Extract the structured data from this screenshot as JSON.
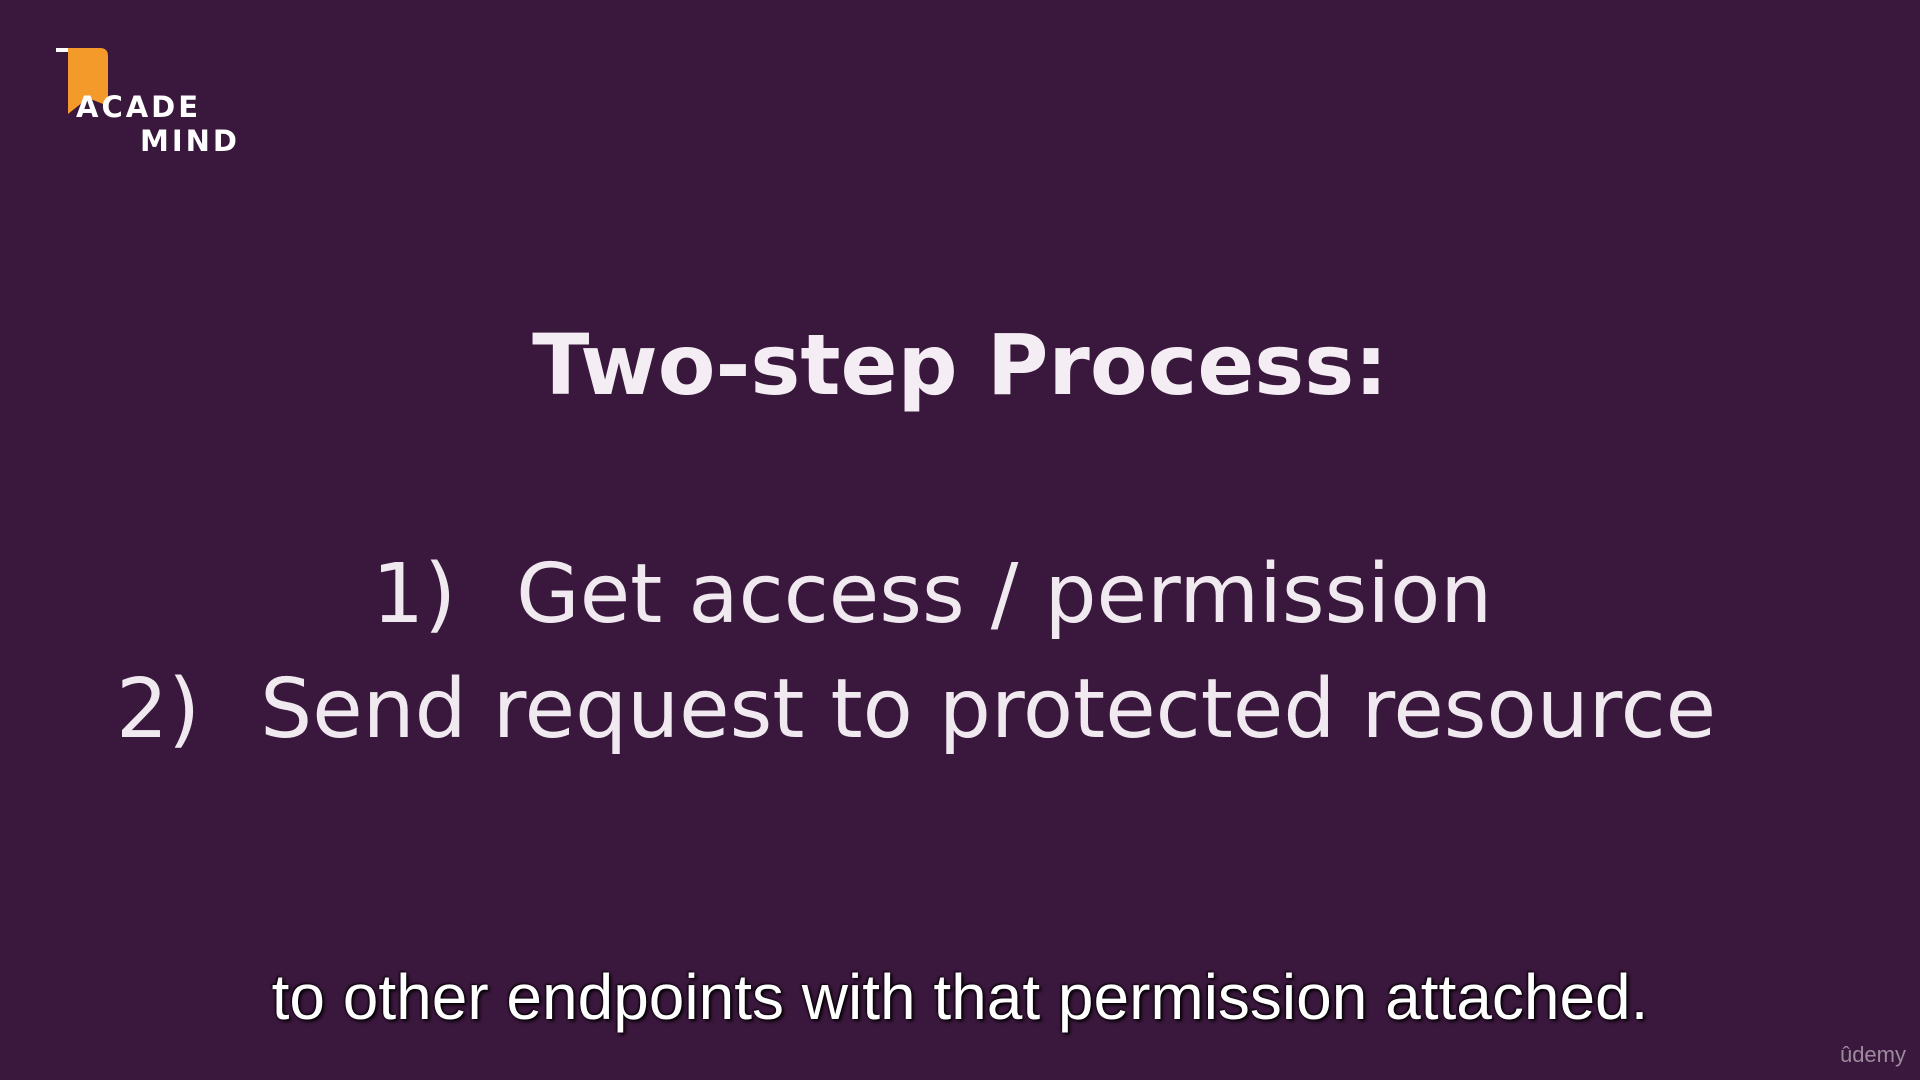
{
  "logo": {
    "line1": "ACADE",
    "line2": "MIND",
    "icon": "bookmark-icon",
    "accent_color": "#f39a2b"
  },
  "slide": {
    "title": "Two-step Process:",
    "steps": [
      {
        "number": "1)",
        "text": "Get access / permission"
      },
      {
        "number": "2)",
        "text": "Send request to protected resource"
      }
    ],
    "background_color": "#3a173c"
  },
  "subtitle": "to other endpoints with that permission attached.",
  "watermark": "ûdemy"
}
